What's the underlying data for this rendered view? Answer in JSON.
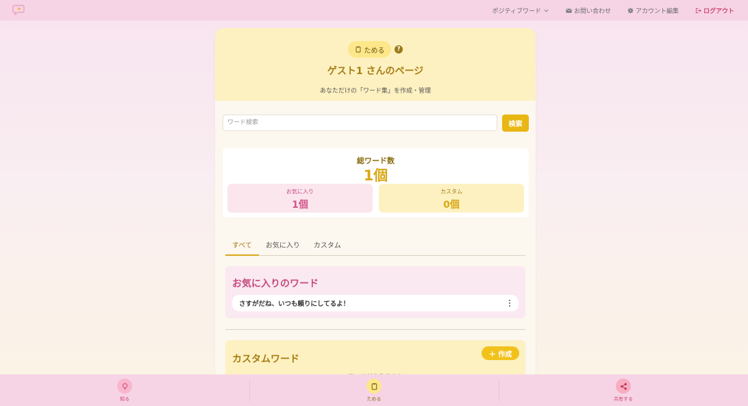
{
  "nav": {
    "logo_icon": "speech-heart-logo",
    "positive_words": "ポジティブワード",
    "contact": "お問い合わせ",
    "account": "アカウント編集",
    "logout": "ログアウト"
  },
  "header": {
    "mode_label": "ためる",
    "help": "?",
    "title": "ゲスト1 さんのページ",
    "subtitle": "あなただけの「ワード集」を作成・管理"
  },
  "search": {
    "placeholder": "ワード検索",
    "button": "検索"
  },
  "stats": {
    "total_label": "総ワード数",
    "total_value": "1個",
    "favorites_label": "お気に入り",
    "favorites_value": "1個",
    "custom_label": "カスタム",
    "custom_value": "0個"
  },
  "tabs": [
    "すべて",
    "お気に入り",
    "カスタム"
  ],
  "favorites": {
    "title": "お気に入りのワード",
    "items": [
      "さすがだね、いつも頼りにしてるよ！"
    ]
  },
  "custom": {
    "title": "カスタムワード",
    "create_button": "＋ 作成",
    "empty": "ワードがありません"
  },
  "bottom_nav": [
    {
      "label": "知る",
      "icon": "lightbulb-icon"
    },
    {
      "label": "ためる",
      "icon": "clipboard-icon"
    },
    {
      "label": "共有する",
      "icon": "share-icon"
    }
  ],
  "colors": {
    "nav_bg": "#f6d4e6",
    "accent_yellow": "#e9b714",
    "accent_pink": "#d1456f"
  }
}
